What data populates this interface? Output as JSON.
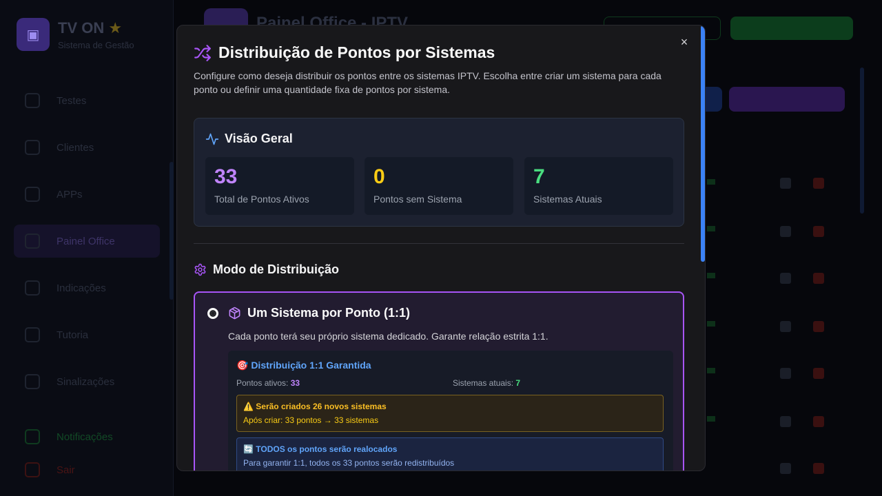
{
  "app": {
    "name": "TV ON",
    "subtitle": "Sistema de Gestão",
    "page_title": "Painel Office - IPTV",
    "sidebar": [
      "Testes",
      "Clientes",
      "APPs",
      "Painel Office",
      "Indicações",
      "Tutoria",
      "Sinalizações",
      "Notificações",
      "Sair"
    ]
  },
  "modal": {
    "title": "Distribuição de Pontos por Sistemas",
    "description": "Configure como deseja distribuir os pontos entre os sistemas IPTV. Escolha entre criar um sistema para cada ponto ou definir uma quantidade fixa de pontos por sistema.",
    "close": "×",
    "overview": {
      "title": "Visão Geral",
      "stats": [
        {
          "value": "33",
          "label": "Total de Pontos Ativos",
          "color": "#c084fc"
        },
        {
          "value": "0",
          "label": "Pontos sem Sistema",
          "color": "#facc15"
        },
        {
          "value": "7",
          "label": "Sistemas Atuais",
          "color": "#4ade80"
        }
      ]
    },
    "mode": {
      "title": "Modo de Distribuição",
      "option": {
        "title": "Um Sistema por Ponto (1:1)",
        "description": "Cada ponto terá seu próprio sistema dedicado. Garante relação estrita 1:1.",
        "detail": {
          "title": "🎯 Distribuição 1:1 Garantida",
          "active_label": "Pontos ativos:",
          "active_value": "33",
          "systems_label": "Sistemas atuais:",
          "systems_value": "7",
          "warning_title": "⚠️ Serão criados 26 novos sistemas",
          "warning_text": "Após criar: 33 pontos → 33 sistemas",
          "info_title": "🔄 TODOS os pontos serão realocados",
          "info_text": "Para garantir 1:1, todos os 33 pontos serão redistribuídos"
        }
      }
    }
  }
}
